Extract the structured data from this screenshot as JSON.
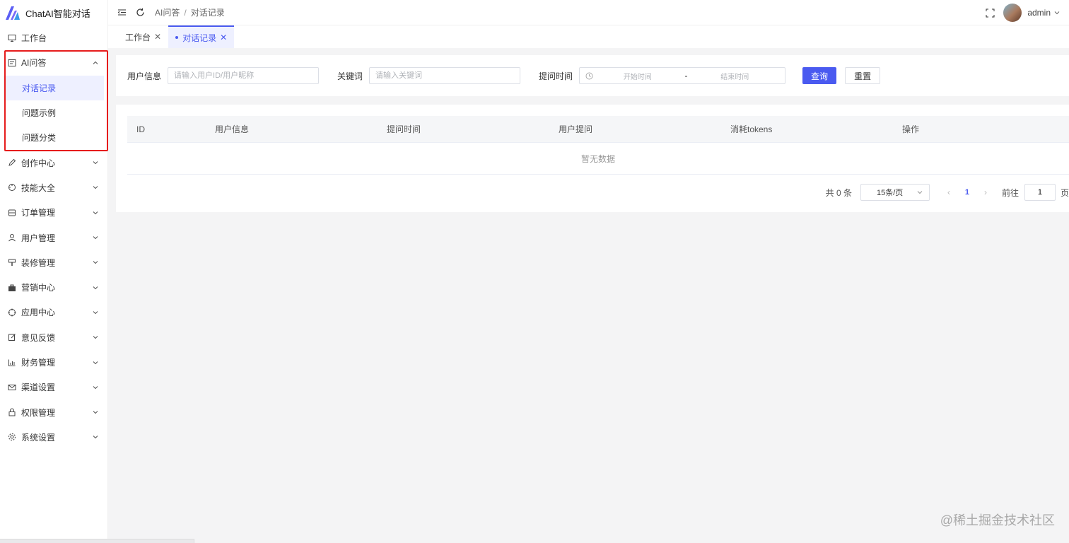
{
  "app": {
    "title": "ChatAI智能对话"
  },
  "sidebar": {
    "items": [
      {
        "label": "工作台",
        "icon": "monitor-icon",
        "expandable": false
      },
      {
        "label": "AI问答",
        "icon": "chat-box-icon",
        "expandable": true,
        "expanded": true,
        "children": [
          {
            "label": "对话记录",
            "active": true
          },
          {
            "label": "问题示例",
            "active": false
          },
          {
            "label": "问题分类",
            "active": false
          }
        ]
      },
      {
        "label": "创作中心",
        "icon": "pen-icon",
        "expandable": true
      },
      {
        "label": "技能大全",
        "icon": "target-icon",
        "expandable": true
      },
      {
        "label": "订单管理",
        "icon": "database-icon",
        "expandable": true
      },
      {
        "label": "用户管理",
        "icon": "user-icon",
        "expandable": true
      },
      {
        "label": "装修管理",
        "icon": "brush-icon",
        "expandable": true
      },
      {
        "label": "营销中心",
        "icon": "briefcase-icon",
        "expandable": true
      },
      {
        "label": "应用中心",
        "icon": "crosshair-icon",
        "expandable": true
      },
      {
        "label": "意见反馈",
        "icon": "edit-icon",
        "expandable": true
      },
      {
        "label": "财务管理",
        "icon": "bar-chart-icon",
        "expandable": true
      },
      {
        "label": "渠道设置",
        "icon": "mail-icon",
        "expandable": true
      },
      {
        "label": "权限管理",
        "icon": "lock-icon",
        "expandable": true
      },
      {
        "label": "系统设置",
        "icon": "gear-icon",
        "expandable": true
      }
    ]
  },
  "header": {
    "breadcrumb": [
      "AI问答",
      "对话记录"
    ],
    "breadcrumb_sep": "/",
    "user": "admin"
  },
  "tabs": [
    {
      "label": "工作台",
      "active": false
    },
    {
      "label": "对话记录",
      "active": true
    }
  ],
  "filters": {
    "user_label": "用户信息",
    "user_placeholder": "请输入用户ID/用户昵称",
    "keyword_label": "关键词",
    "keyword_placeholder": "请输入关键词",
    "time_label": "提问时间",
    "time_start_placeholder": "开始时间",
    "time_separator": "-",
    "time_end_placeholder": "结束时间",
    "query_button": "查询",
    "reset_button": "重置"
  },
  "table": {
    "columns": [
      "ID",
      "用户信息",
      "提问时间",
      "用户提问",
      "消耗tokens",
      "操作"
    ],
    "rows": [],
    "empty_text": "暂无数据"
  },
  "pagination": {
    "total_text": "共 0 条",
    "page_size": "15条/页",
    "prev": "‹",
    "current_page": "1",
    "next": "›",
    "goto_label": "前往",
    "goto_value": "1",
    "page_unit": "页"
  },
  "watermark": "@稀土掘金技术社区",
  "colors": {
    "primary": "#4a5af0",
    "highlight_box": "#e61c1c",
    "active_bg": "#eef0ff"
  }
}
